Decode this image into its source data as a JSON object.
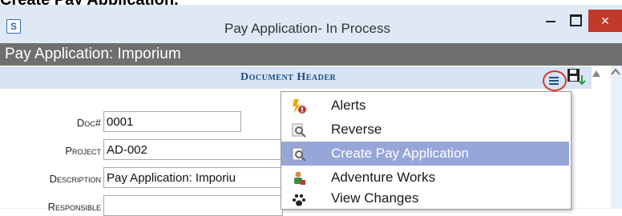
{
  "page_heading": "Create Pay Application.",
  "window": {
    "title": "Pay Application- In Process",
    "app_icon": "S",
    "controls": [
      "minimize-icon",
      "maximize-icon",
      "close-icon"
    ],
    "close_label": "×"
  },
  "app": {
    "title": "Pay Application: Imporium"
  },
  "section": {
    "title": "Document Header",
    "icons": [
      "menu-icon",
      "save-down-icon",
      "collapse-up-icon"
    ]
  },
  "fields": [
    {
      "label": "Doc#",
      "value": "0001"
    },
    {
      "label": "Project",
      "value": "AD-002"
    },
    {
      "label": "Description",
      "value": "Pay Application: Imporiu"
    },
    {
      "label": "Responsible",
      "value": ""
    }
  ],
  "menu": {
    "items": [
      {
        "label": "Alerts",
        "icon": "alert-icon",
        "selected": false
      },
      {
        "label": "Reverse",
        "icon": "reverse-icon",
        "selected": false
      },
      {
        "label": "Create Pay Application",
        "icon": "create-pay-application-icon",
        "selected": true
      },
      {
        "label": "Adventure Works",
        "icon": "adventure-works-icon",
        "selected": false
      },
      {
        "label": "View Changes",
        "icon": "view-changes-icon",
        "selected": false
      }
    ]
  },
  "colors": {
    "titlebar": "#dfe9f6",
    "app_header": "#6f6f6f",
    "doc_header": "#d6e4f5",
    "menu_selected": "#97a6d9",
    "close_button": "#c0392b",
    "highlight_circle": "#d23a2d"
  }
}
